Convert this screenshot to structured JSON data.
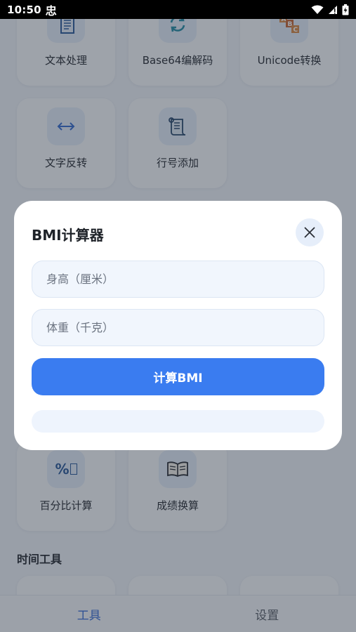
{
  "status_bar": {
    "time": "10:50",
    "notification_icon": "notification-glyph-icon",
    "icons": [
      "wifi-icon",
      "signal-icon",
      "battery-icon"
    ]
  },
  "background": {
    "tiles": [
      {
        "label": "文本处理",
        "icon": "document-icon",
        "glyph": "📄"
      },
      {
        "label": "Base64编解码",
        "icon": "refresh-icon",
        "glyph": "🔄"
      },
      {
        "label": "Unicode转换",
        "icon": "abc-blocks-icon",
        "glyph": "🔤"
      },
      {
        "label": "文字反转",
        "icon": "left-right-arrow-icon",
        "glyph": "↔"
      },
      {
        "label": "行号添加",
        "icon": "scroll-icon",
        "glyph": "📜"
      },
      {
        "label": "百分比计算",
        "icon": "percent-icon",
        "glyph": "%"
      },
      {
        "label": "成绩换算",
        "icon": "book-icon",
        "glyph": "📖"
      }
    ],
    "section_time_tools": "时间工具"
  },
  "bottom_nav": {
    "tools": "工具",
    "settings": "设置"
  },
  "dialog": {
    "title": "BMI计算器",
    "height_placeholder": "身高（厘米）",
    "height_value": "",
    "weight_placeholder": "体重（千克）",
    "weight_value": "",
    "calculate_label": "计算BMI",
    "result_text": ""
  },
  "colors": {
    "accent": "#3a7cf0",
    "input_bg": "#f1f6fd",
    "icon_bg": "#e6eefa"
  }
}
